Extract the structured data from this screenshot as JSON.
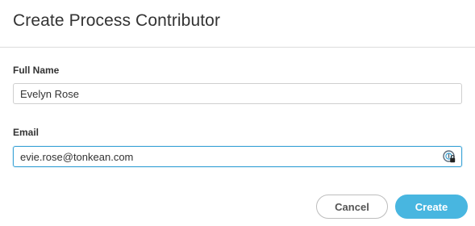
{
  "dialog": {
    "title": "Create Process Contributor",
    "fields": {
      "full_name": {
        "label": "Full Name",
        "value": "Evelyn Rose",
        "placeholder": ""
      },
      "email": {
        "label": "Email",
        "value": "evie.rose@tonkean.com",
        "placeholder": ""
      }
    },
    "password_manager_icon": "password-manager-icon",
    "buttons": {
      "cancel": "Cancel",
      "create": "Create"
    },
    "colors": {
      "accent": "#48b6e0",
      "focus_border": "#3aa3d6"
    }
  }
}
